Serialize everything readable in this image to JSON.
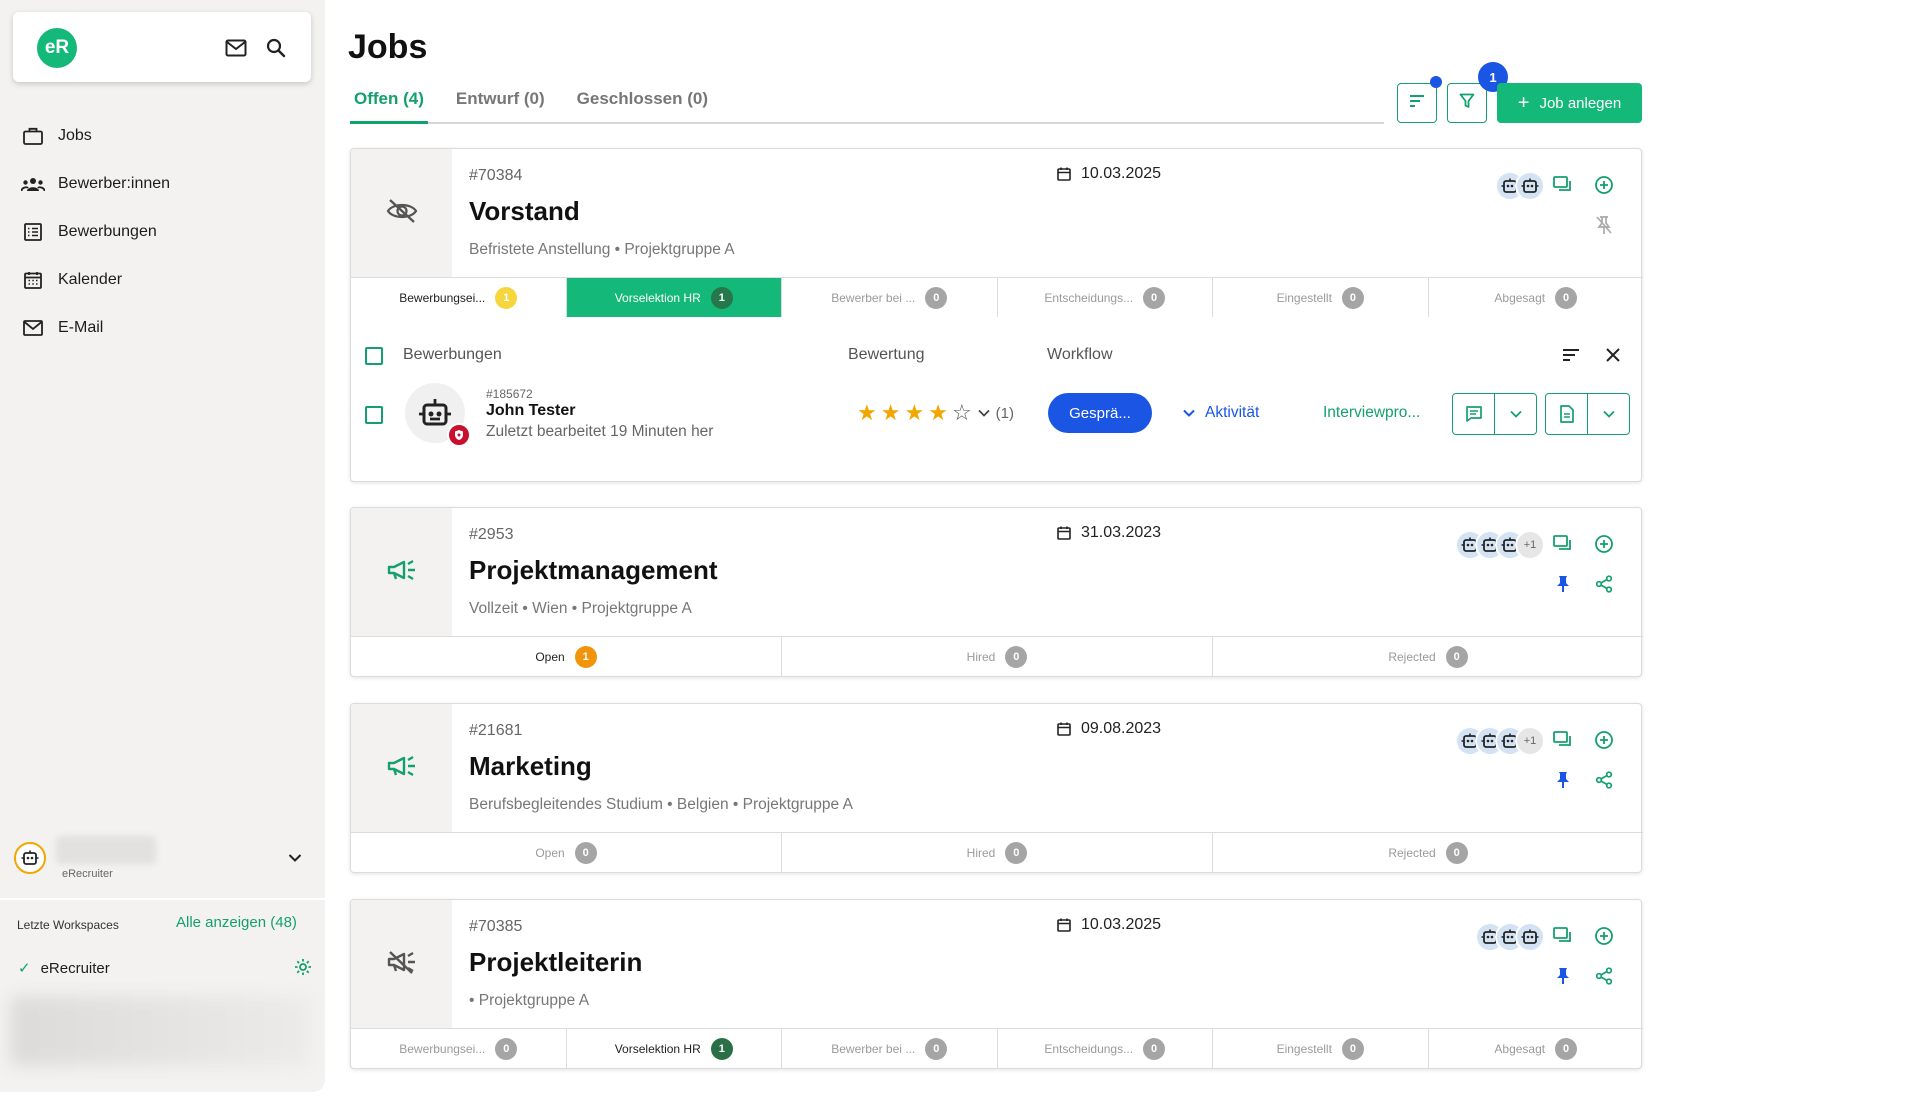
{
  "sidebar": {
    "logo_text": "eR",
    "nav": [
      {
        "label": "Jobs",
        "icon": "briefcase-icon"
      },
      {
        "label": "Bewerber:innen",
        "icon": "people-icon"
      },
      {
        "label": "Bewerbungen",
        "icon": "list-icon"
      },
      {
        "label": "Kalender",
        "icon": "calendar-icon"
      },
      {
        "label": "E-Mail",
        "icon": "mail-icon"
      }
    ],
    "user_org": "eRecruiter",
    "workspaces_title": "Letzte Workspaces",
    "workspaces_all": "Alle anzeigen (48)",
    "workspace_current": "eRecruiter"
  },
  "main": {
    "title": "Jobs",
    "tabs": [
      {
        "label": "Offen (4)",
        "active": true
      },
      {
        "label": "Entwurf (0)",
        "active": false
      },
      {
        "label": "Geschlossen (0)",
        "active": false
      }
    ],
    "filter_badge": "1",
    "create_button": "Job anlegen"
  },
  "jobs": [
    {
      "id": "#70384",
      "title": "Vorstand",
      "meta": "Befristete Anstellung • Projektgruppe A",
      "date": "10.03.2025",
      "stages": [
        {
          "label": "Bewerbungsei...",
          "count": "1",
          "style": "yellow",
          "state": "dark"
        },
        {
          "label": "Vorselektion HR",
          "count": "1",
          "style": "green",
          "state": "active"
        },
        {
          "label": "Bewerber bei ...",
          "count": "0",
          "style": "grey",
          "state": "muted"
        },
        {
          "label": "Entscheidungs...",
          "count": "0",
          "style": "grey",
          "state": "muted"
        },
        {
          "label": "Eingestellt",
          "count": "0",
          "style": "grey",
          "state": "muted"
        },
        {
          "label": "Abgesagt",
          "count": "0",
          "style": "grey",
          "state": "muted"
        }
      ],
      "applications": {
        "col_applications": "Bewerbungen",
        "col_rating": "Bewertung",
        "col_workflow": "Workflow",
        "candidate": {
          "id": "#185672",
          "name": "John Tester",
          "edited": "Zuletzt bearbeitet 19 Minuten her",
          "rating": 4,
          "rating_max": 5,
          "rating_count": "(1)",
          "workflow_button": "Gesprä...",
          "activity": "Aktivität",
          "interview": "Interviewpro..."
        }
      }
    },
    {
      "id": "#2953",
      "title": "Projektmanagement",
      "meta": "Vollzeit • Wien • Projektgruppe A",
      "date": "31.03.2023",
      "avatar_more": "+1",
      "stages": [
        {
          "label": "Open",
          "count": "1",
          "style": "orange",
          "state": "dark"
        },
        {
          "label": "Hired",
          "count": "0",
          "style": "grey",
          "state": "muted"
        },
        {
          "label": "Rejected",
          "count": "0",
          "style": "grey",
          "state": "muted"
        }
      ]
    },
    {
      "id": "#21681",
      "title": "Marketing",
      "meta": "Berufsbegleitendes Studium • Belgien • Projektgruppe A",
      "date": "09.08.2023",
      "avatar_more": "+1",
      "stages": [
        {
          "label": "Open",
          "count": "0",
          "style": "grey",
          "state": "muted"
        },
        {
          "label": "Hired",
          "count": "0",
          "style": "grey",
          "state": "muted"
        },
        {
          "label": "Rejected",
          "count": "0",
          "style": "grey",
          "state": "muted"
        }
      ]
    },
    {
      "id": "#70385",
      "title": "Projektleiterin",
      "meta": "• Projektgruppe A",
      "date": "10.03.2025",
      "stages": [
        {
          "label": "Bewerbungsei...",
          "count": "0",
          "style": "grey",
          "state": "muted"
        },
        {
          "label": "Vorselektion HR",
          "count": "1",
          "style": "dgreen",
          "state": "dark"
        },
        {
          "label": "Bewerber bei ...",
          "count": "0",
          "style": "grey",
          "state": "muted"
        },
        {
          "label": "Entscheidungs...",
          "count": "0",
          "style": "grey",
          "state": "muted"
        },
        {
          "label": "Eingestellt",
          "count": "0",
          "style": "grey",
          "state": "muted"
        },
        {
          "label": "Abgesagt",
          "count": "0",
          "style": "grey",
          "state": "muted"
        }
      ]
    }
  ],
  "colors": {
    "accent": "#14b878",
    "accent_dark": "#14a06c",
    "blue": "#1a55e3",
    "sidebar_bg": "#f3f2f0"
  }
}
